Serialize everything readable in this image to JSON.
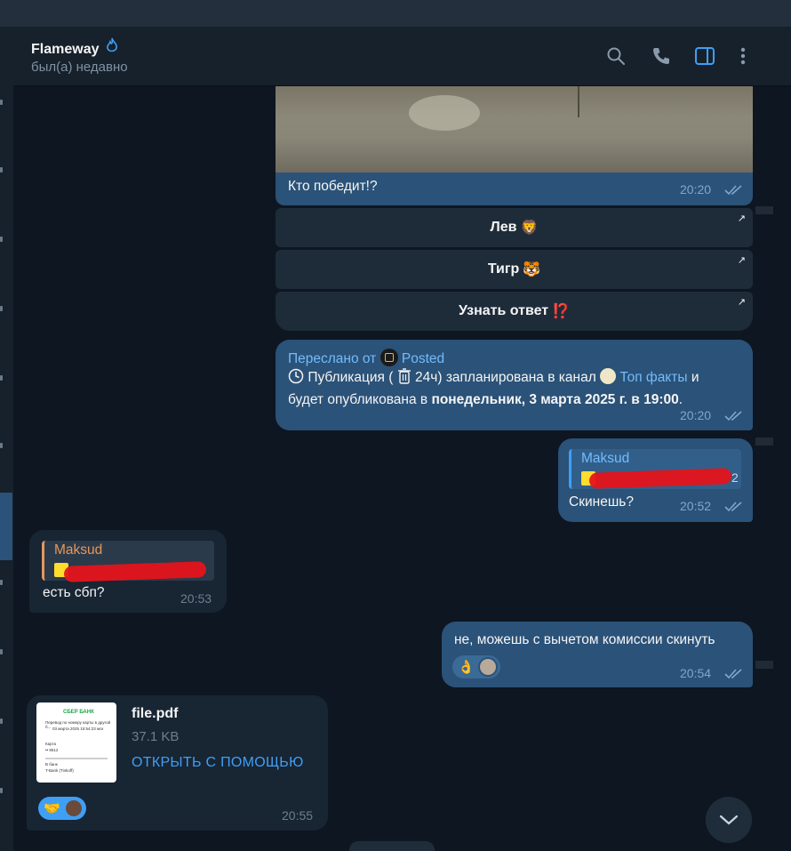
{
  "header": {
    "contact_name": "Flameway",
    "name_emoji": "💧",
    "status": "был(а) недавно",
    "icons": [
      "search-icon",
      "phone-icon",
      "sidebar-toggle-icon",
      "more-vertical-icon"
    ]
  },
  "colors": {
    "outgoing_bubble": "#2b5278",
    "incoming_bubble": "#182533",
    "accent": "#3f9ff5",
    "background": "#0e1621"
  },
  "messages": {
    "media_caption": {
      "text": "Кто победит!?",
      "time": "20:20"
    },
    "keyboard": [
      {
        "label": "Лев",
        "emoji": "🦁"
      },
      {
        "label": "Тигр",
        "emoji": "🐯"
      },
      {
        "label": "Узнать ответ",
        "emoji": "⁉️"
      }
    ],
    "forwarded": {
      "prefix": "Переслано от",
      "source": "Posted",
      "line1_a": "Публикация (",
      "line1_b": "24ч) запланирована в канал",
      "channel": "Топ факты",
      "line1_c": "и",
      "line2_a": "будет опубликована в",
      "line2_bold": "понедельник, 3 марта 2025 г. в 19:00",
      "line2_end": ".",
      "time": "20:20"
    },
    "reply_out": {
      "quote_author": "Maksud",
      "quote_tail": "2",
      "text": "Скинешь?",
      "time": "20:52"
    },
    "reply_in": {
      "quote_author": "Maksud",
      "text": "есть сбп?",
      "time": "20:53"
    },
    "commission": {
      "text": "не, можешь с вычетом комиссии скинуть",
      "reaction": "👌",
      "time": "20:54"
    },
    "file": {
      "name": "file.pdf",
      "size": "37.1 KB",
      "action": "ОТКРЫТЬ С ПОМОЩЬЮ",
      "reaction": "🤝",
      "time": "20:55",
      "thumb": {
        "bank": "СБЕР БАНК",
        "line_a": "Перевод по номеру карты в другой б...",
        "line_b": "03 марта 2025 15:54:23 мск",
        "label_card": "Карта",
        "card": "•• 8512",
        "label_bank": "В банк",
        "bank_dest": "T-Bank (Tinkoff)"
      }
    }
  }
}
